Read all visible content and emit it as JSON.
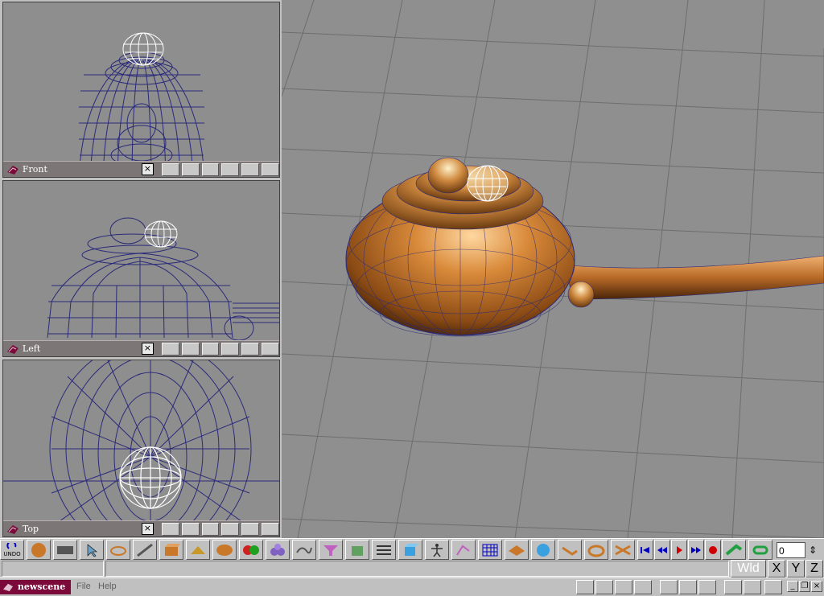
{
  "viewports": {
    "front": {
      "label": "Front",
      "close": "×"
    },
    "left": {
      "label": "Left",
      "close": "×"
    },
    "top": {
      "label": "Top",
      "close": "×"
    }
  },
  "toolbar": {
    "undo_label": "UNDO",
    "frame_value": "0",
    "tool_icons": [
      "undo-icon",
      "sphere-icon",
      "film-icon",
      "select-arrow-icon",
      "rotate-icon",
      "edge-icon",
      "box-icon",
      "pyramid-icon",
      "ellipsoid-icon",
      "color-balls-icon",
      "blob-icon",
      "curve-icon",
      "funnel-icon",
      "cube-face-icon",
      "list-icon",
      "cube-blue-icon",
      "figure-icon",
      "bones-icon",
      "grid-icon",
      "terrain-icon",
      "3d-text-icon",
      "extrude-icon",
      "lathe-icon",
      "deform-icon"
    ]
  },
  "playback": {
    "icons": [
      "rewind-start-icon",
      "rewind-icon",
      "play-icon",
      "fast-forward-icon",
      "record-icon",
      "key-icon",
      "loop-icon"
    ]
  },
  "status": {
    "mode": "Wld",
    "axes": [
      "X",
      "Y",
      "Z"
    ]
  },
  "taskbar": {
    "scene_name": "newscene",
    "menu": [
      "File",
      "Help"
    ]
  },
  "colors": {
    "viewport_bg": "#8e8e8e",
    "wire": "#2a2a7a",
    "object": "#c9782a",
    "scene_bar": "#7b0a3a"
  }
}
